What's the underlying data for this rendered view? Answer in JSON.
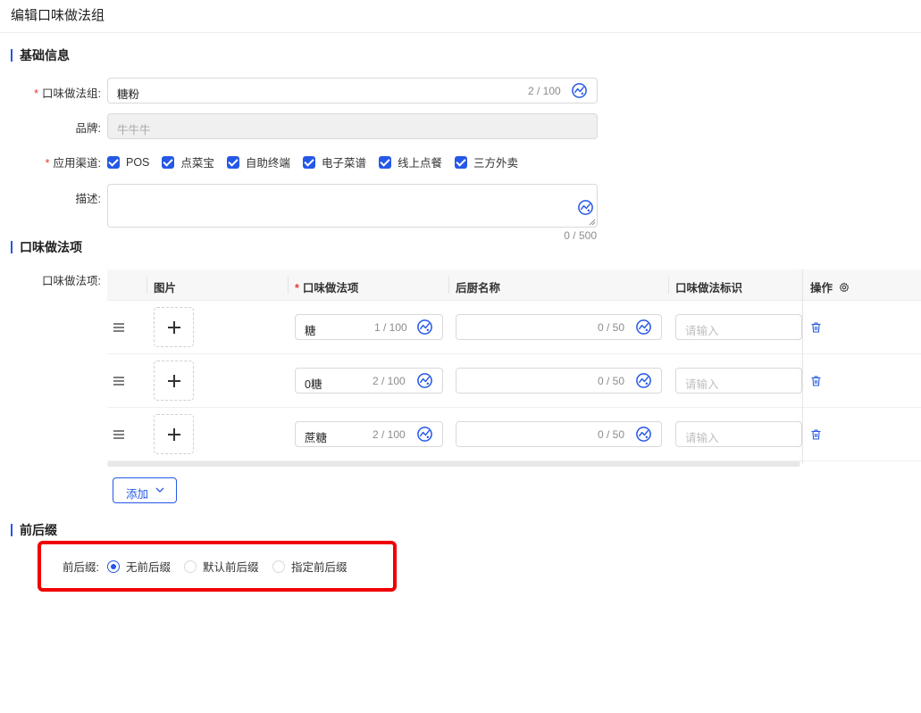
{
  "header": {
    "title": "编辑口味做法组"
  },
  "basic": {
    "section_title": "基础信息",
    "group_label": "口味做法组:",
    "group_value": "糖粉",
    "group_count": "2 / 100",
    "brand_label": "品牌:",
    "brand_value": "牛牛牛",
    "channels_label": "应用渠道:",
    "channels": [
      "POS",
      "点菜宝",
      "自助终端",
      "电子菜谱",
      "线上点餐",
      "三方外卖"
    ],
    "desc_label": "描述:",
    "desc_count": "0 / 500"
  },
  "items": {
    "section_title": "口味做法项",
    "field_label": "口味做法项:",
    "columns": {
      "image": "图片",
      "name": "口味做法项",
      "kitchen": "后厨名称",
      "tag": "口味做法标识",
      "action": "操作"
    },
    "rows": [
      {
        "name": "糖",
        "name_count": "1 / 100",
        "kitchen_count": "0 / 50",
        "tag_placeholder": "请输入"
      },
      {
        "name": "0糖",
        "name_count": "2 / 100",
        "kitchen_count": "0 / 50",
        "tag_placeholder": "请输入"
      },
      {
        "name": "蔗糖",
        "name_count": "2 / 100",
        "kitchen_count": "0 / 50",
        "tag_placeholder": "请输入"
      }
    ],
    "add_label": "添加"
  },
  "affix": {
    "section_title": "前后缀",
    "label": "前后缀:",
    "options": [
      "无前后缀",
      "默认前后缀",
      "指定前后缀"
    ],
    "selected": "无前后缀"
  },
  "colors": {
    "accent": "#2458e6",
    "required": "#e53935",
    "highlight": "#f00000"
  },
  "icons": [
    "ai-assist-icon",
    "drag-handle-icon",
    "plus-icon",
    "trash-icon",
    "gear-icon",
    "chevron-down-icon"
  ]
}
